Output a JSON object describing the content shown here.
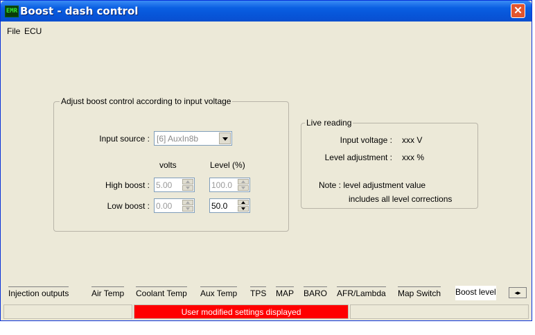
{
  "window": {
    "icon_text": "EMR",
    "title": "Boost - dash control",
    "close_glyph": "✕"
  },
  "menu": [
    "File",
    "ECU"
  ],
  "boost_group": {
    "legend": "Adjust boost control according to input voltage",
    "input_source_label": "Input source :",
    "input_source_value": "[6]  AuxIn8b",
    "col_volts": "volts",
    "col_level": "Level (%)",
    "high_boost_label": "High boost :",
    "high_boost_volts": "5.00",
    "high_boost_level": "100.0",
    "low_boost_label": "Low boost :",
    "low_boost_volts": "0.00",
    "low_boost_level": "50.0"
  },
  "live_group": {
    "legend": "Live reading",
    "input_voltage_label": "Input voltage :",
    "input_voltage_value": "xxx V",
    "level_adj_label": "Level adjustment :",
    "level_adj_value": "xxx %",
    "note_line1": "Note : level adjustment value",
    "note_line2": "includes all level corrections"
  },
  "tabs": [
    "Injection outputs",
    "Air Temp",
    "Coolant Temp",
    "Aux Temp",
    "TPS",
    "MAP",
    "BARO",
    "AFR/Lambda",
    "Map Switch",
    "Boost level"
  ],
  "active_tab": "Boost level",
  "tab_scroll_glyph": "◂▸",
  "status": {
    "message": "User modified settings displayed",
    "alert_color": "#ff0000"
  },
  "colors": {
    "titlebar": "#0755d8",
    "window_bg": "#ece9d8",
    "close_button": "#e1552e"
  }
}
